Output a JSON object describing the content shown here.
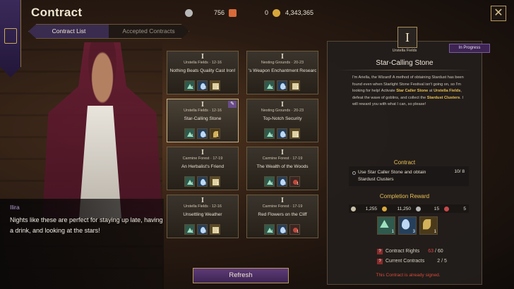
{
  "header": {
    "title": "Contract"
  },
  "currency": [
    {
      "icon": "silver-coin-icon",
      "color": "#b8b8b8",
      "value": "756"
    },
    {
      "icon": "ticket-icon",
      "color": "#d96a3a",
      "value": "0"
    },
    {
      "icon": "gold-coin-icon",
      "color": "#d9a83a",
      "value": "4,343,365"
    }
  ],
  "tabs": [
    {
      "label": "Contract List",
      "active": true
    },
    {
      "label": "Accepted Contracts",
      "active": false
    }
  ],
  "npc": {
    "name": "Ilira",
    "line": "Nights like these are perfect for staying up late, having a drink, and looking at the stars!"
  },
  "cards": [
    {
      "rank": "I",
      "location": "Urstella Fields · 12-16",
      "title": "Nothing Beats Quality Cast Iron!",
      "rewards": [
        {
          "type": "gem",
          "n": "1"
        },
        {
          "type": "drop",
          "n": "3"
        },
        {
          "type": "scroll",
          "n": "1"
        }
      ]
    },
    {
      "rank": "I",
      "location": "Nesting Grounds · 20-23",
      "title": "'s Weapon Enchantment Research",
      "rewards": [
        {
          "type": "gem",
          "n": "1"
        },
        {
          "type": "drop",
          "n": "3"
        },
        {
          "type": "scroll",
          "n": "1"
        }
      ]
    },
    {
      "rank": "I",
      "location": "Urstella Fields · 12-16",
      "title": "Star-Calling Stone",
      "rewards": [
        {
          "type": "gem",
          "n": "1"
        },
        {
          "type": "drop",
          "n": "3"
        },
        {
          "type": "leaf",
          "n": "1"
        }
      ]
    },
    {
      "rank": "I",
      "location": "Nesting Grounds · 20-23",
      "title": "Top-Notch Security",
      "rewards": [
        {
          "type": "gem",
          "n": "1"
        },
        {
          "type": "drop",
          "n": "3"
        },
        {
          "type": "scroll",
          "n": "1"
        }
      ]
    },
    {
      "rank": "I",
      "location": "Carmine Forest · 17-19",
      "title": "An Herbalist's Friend",
      "rewards": [
        {
          "type": "gem",
          "n": "1"
        },
        {
          "type": "drop",
          "n": "3"
        },
        {
          "type": "scroll",
          "n": "1"
        }
      ]
    },
    {
      "rank": "I",
      "location": "Carmine Forest · 17-19",
      "title": "The Wealth of the Woods",
      "rewards": [
        {
          "type": "gem",
          "n": "1"
        },
        {
          "type": "drop",
          "n": "3"
        },
        {
          "type": "flower",
          "n": "1"
        }
      ]
    },
    {
      "rank": "I",
      "location": "Urstella Fields · 12-16",
      "title": "Unsettling Weather",
      "rewards": [
        {
          "type": "gem",
          "n": "1"
        },
        {
          "type": "drop",
          "n": "3"
        },
        {
          "type": "scroll",
          "n": "1"
        }
      ]
    },
    {
      "rank": "I",
      "location": "Carmine Forest · 17-19",
      "title": "Red Flowers on the Cliff",
      "rewards": [
        {
          "type": "gem",
          "n": "1"
        },
        {
          "type": "drop",
          "n": "3"
        },
        {
          "type": "flower",
          "n": "1"
        }
      ]
    }
  ],
  "refresh_label": "Refresh",
  "detail": {
    "rank": "I",
    "location": "Urstella Fields",
    "status": "In Progress",
    "title": "Star-Calling Stone",
    "desc_parts": [
      {
        "t": "I'm Ariella, the Wizard! A method of obtaining Stardust has been found even when Starlight Stone Festival isn't going on, so I'm looking for help! Activate ",
        "b": false
      },
      {
        "t": "Star Caller Stone",
        "b": true
      },
      {
        "t": " at ",
        "b": false
      },
      {
        "t": "Urstella Fields",
        "b": true
      },
      {
        "t": ", defeat the wave of goblins, and collect the ",
        "b": false
      },
      {
        "t": "Stardust Clusters",
        "b": true
      },
      {
        "t": ". I will reward you with what I can, so please!",
        "b": false
      }
    ],
    "contract_heading": "Contract",
    "objective": "Use Star Caller Stone and obtain Stardust Clusters",
    "objective_count": "10/ 8",
    "reward_heading": "Completion Reward",
    "reward_currencies": [
      {
        "icon": "exp-icon",
        "color": "#c9c0a8",
        "value": "1,255"
      },
      {
        "icon": "gold-coin-icon",
        "color": "#d9a83a",
        "value": "11,250"
      },
      {
        "icon": "silver-coin-icon",
        "color": "#b8b8b8",
        "value": "15"
      },
      {
        "icon": "heart-icon",
        "color": "#c84848",
        "value": "5"
      }
    ],
    "reward_items": [
      {
        "type": "gem",
        "n": "1"
      },
      {
        "type": "drop",
        "n": "3"
      },
      {
        "type": "leaf",
        "n": "1"
      }
    ],
    "rights_label": "Contract Rights",
    "rights_current": "63",
    "rights_max": "/ 60",
    "current_label": "Current Contracts",
    "current_value": "2 / 5",
    "signed_msg": "This Contract is already signed."
  }
}
